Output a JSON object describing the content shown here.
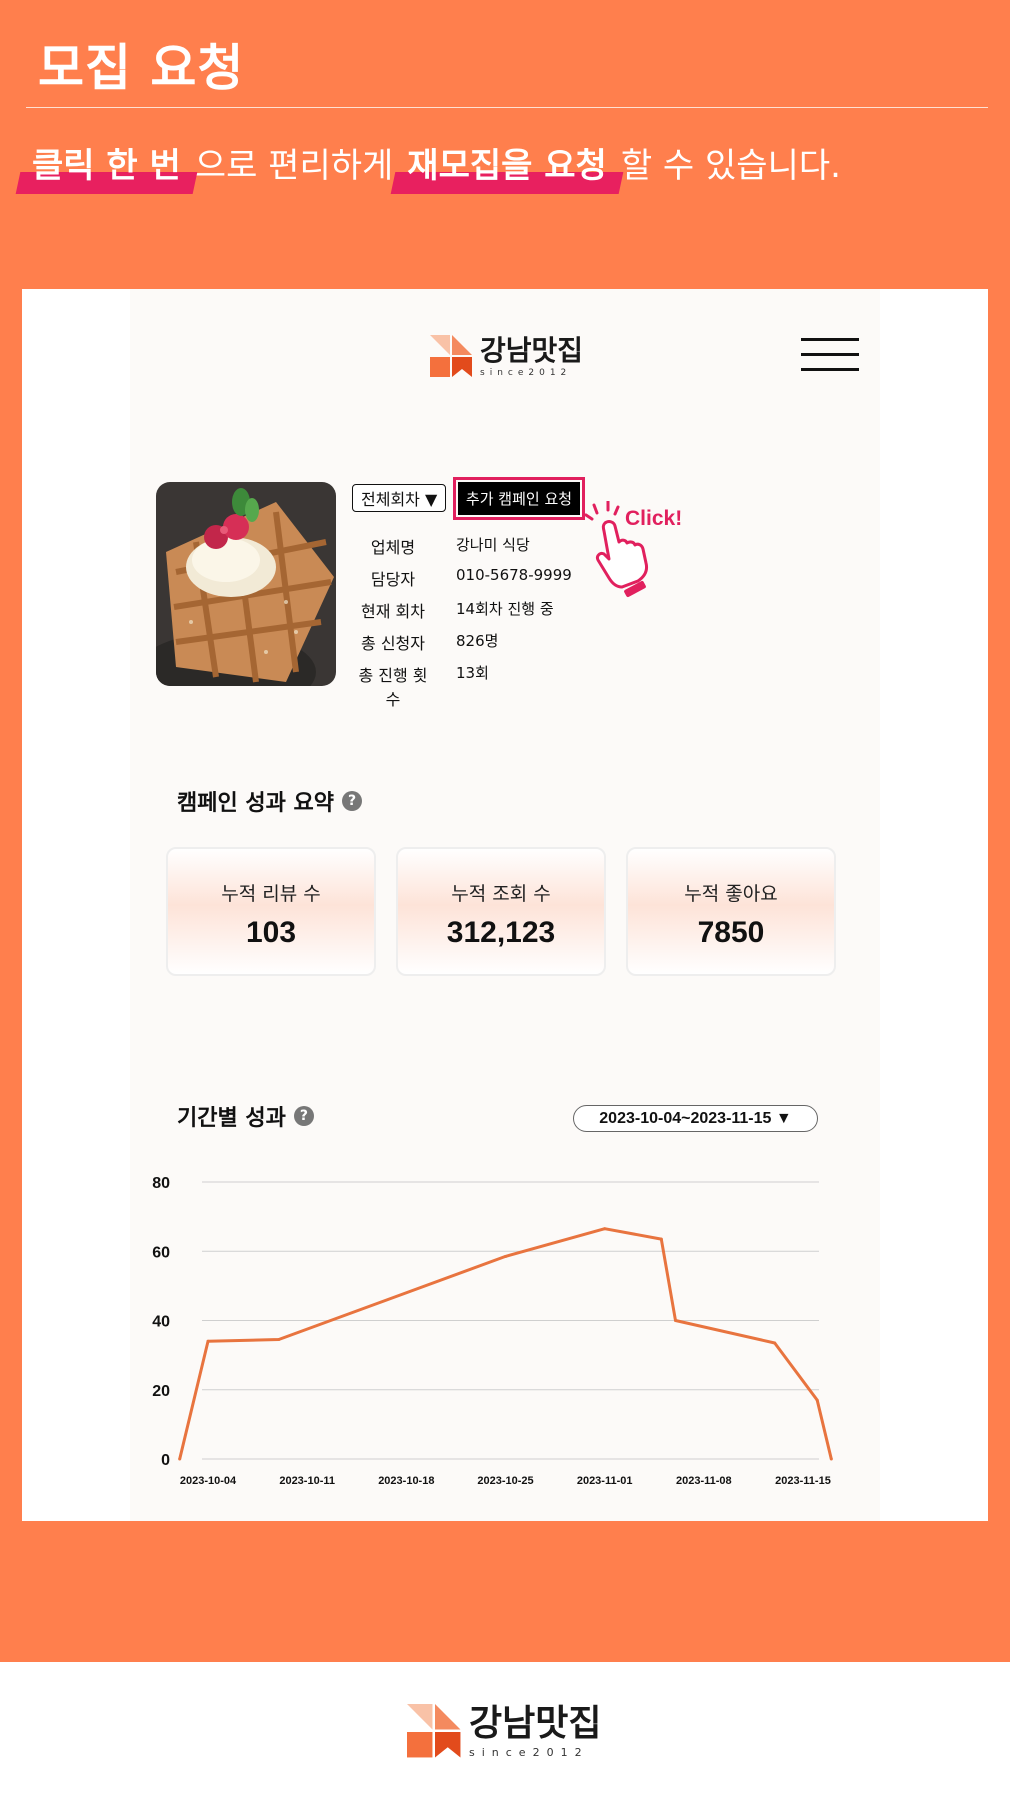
{
  "hero": {
    "title": "모집 요청",
    "hl1": "클릭 한 번",
    "mid1": "으로 편리하게",
    "hl2": "재모집을 요청",
    "tail": "할 수 있습니다."
  },
  "header": {
    "logo_name": "강남맛집",
    "logo_since": "since2012"
  },
  "store": {
    "round_select": "전체회차 ▼",
    "request_button": "추가 캠페인 요청",
    "click_hint": "Click!",
    "rows": [
      {
        "label": "업체명",
        "value": "강나미 식당"
      },
      {
        "label": "담당자",
        "value": "010-5678-9999"
      },
      {
        "label": "현재 회차",
        "value": "14회차 진행 중"
      },
      {
        "label": "총 신청자",
        "value": "826명"
      },
      {
        "label": "총 진행 횟수",
        "value": "13회"
      }
    ]
  },
  "summary": {
    "title": "캠페인 성과 요약",
    "help": "?",
    "cards": [
      {
        "label": "누적 리뷰 수",
        "value": "103"
      },
      {
        "label": "누적 조회 수",
        "value": "312,123"
      },
      {
        "label": "누적 좋아요",
        "value": "7850"
      }
    ]
  },
  "period": {
    "title": "기간별 성과",
    "help": "?",
    "date_range": "2023-10-04~2023-11-15 ▼"
  },
  "chart_data": {
    "type": "line",
    "ylim": [
      0,
      80
    ],
    "yticks": [
      0,
      20,
      40,
      60,
      80
    ],
    "xticks": [
      "2023-10-04",
      "2023-10-11",
      "2023-10-18",
      "2023-10-25",
      "2023-11-01",
      "2023-11-08",
      "2023-11-15"
    ],
    "x": [
      "2023-10-02",
      "2023-10-04",
      "2023-10-09",
      "2023-10-25",
      "2023-11-01",
      "2023-11-05",
      "2023-11-06",
      "2023-11-13",
      "2023-11-16",
      "2023-11-17"
    ],
    "values": [
      0,
      34,
      34.5,
      58.5,
      66.5,
      63.5,
      40,
      33.5,
      17,
      0
    ],
    "line_color": "#e8743f"
  },
  "footer": {
    "logo_name": "강남맛집",
    "logo_since": "since2012"
  }
}
